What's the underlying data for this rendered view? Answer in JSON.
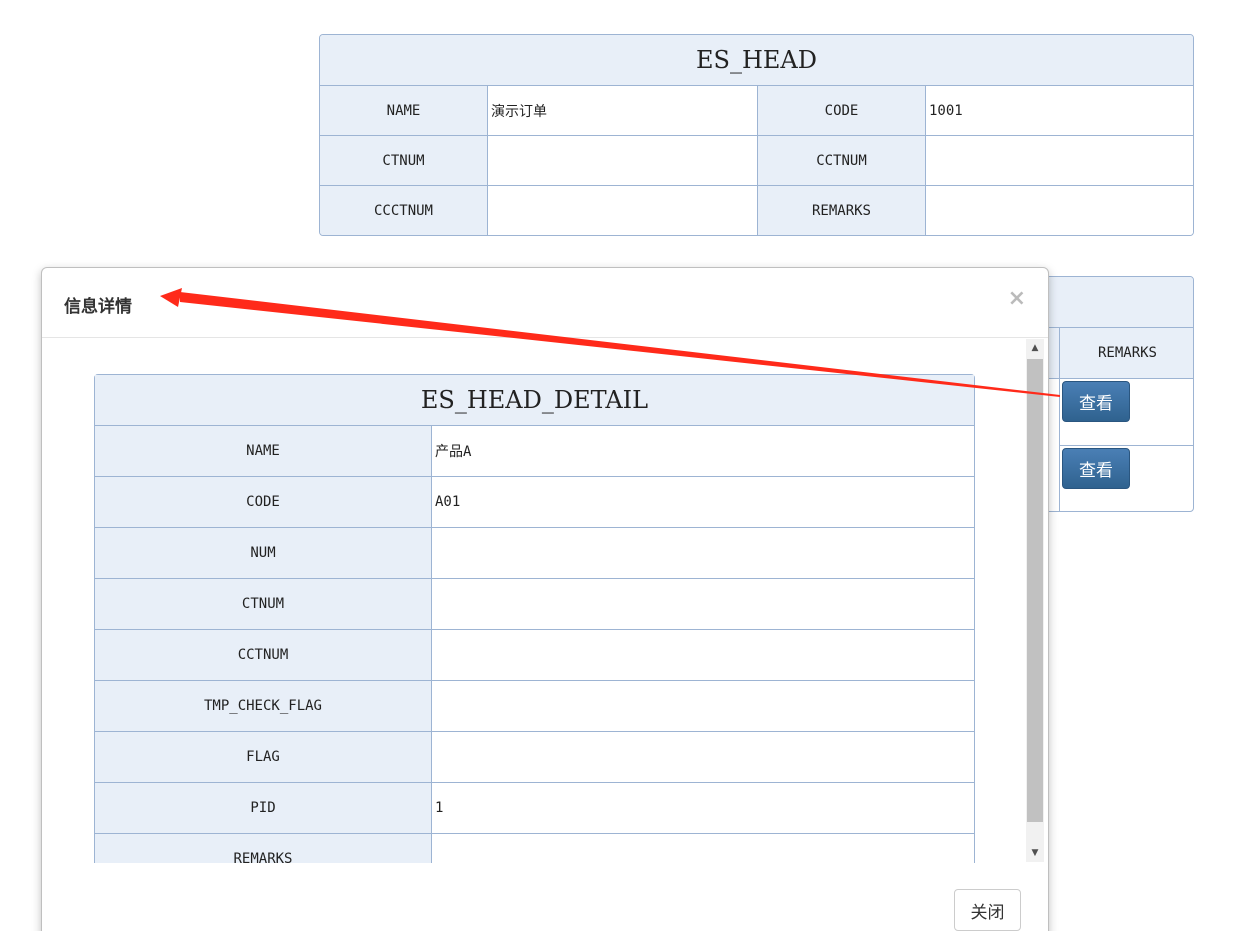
{
  "head_table": {
    "title": "ES_HEAD",
    "rows": [
      [
        {
          "label": "NAME",
          "value": "演示订单"
        },
        {
          "label": "CODE",
          "value": "1001"
        }
      ],
      [
        {
          "label": "CTNUM",
          "value": ""
        },
        {
          "label": "CCTNUM",
          "value": ""
        }
      ],
      [
        {
          "label": "CCCTNUM",
          "value": ""
        },
        {
          "label": "REMARKS",
          "value": ""
        }
      ]
    ]
  },
  "detail_list": {
    "column_header": "REMARKS",
    "view_button_label": "查看"
  },
  "modal": {
    "title": "信息详情",
    "close_symbol": "×",
    "detail_title": "ES_HEAD_DETAIL",
    "fields": [
      {
        "label": "NAME",
        "value": "产品A"
      },
      {
        "label": "CODE",
        "value": "A01"
      },
      {
        "label": "NUM",
        "value": ""
      },
      {
        "label": "CTNUM",
        "value": ""
      },
      {
        "label": "CCTNUM",
        "value": ""
      },
      {
        "label": "TMP_CHECK_FLAG",
        "value": ""
      },
      {
        "label": "FLAG",
        "value": ""
      },
      {
        "label": "PID",
        "value": "1"
      },
      {
        "label": "REMARKS",
        "value": ""
      }
    ],
    "close_button_label": "关闭"
  },
  "colors": {
    "label_bg": "#e8eff8",
    "border": "#9db4d3",
    "button_blue": "#3a6fa0",
    "annotation_arrow": "#ff2a1a"
  },
  "icons": {
    "modal_close": "close-icon",
    "scroll_up": "triangle-up-icon",
    "scroll_down": "triangle-down-icon"
  }
}
